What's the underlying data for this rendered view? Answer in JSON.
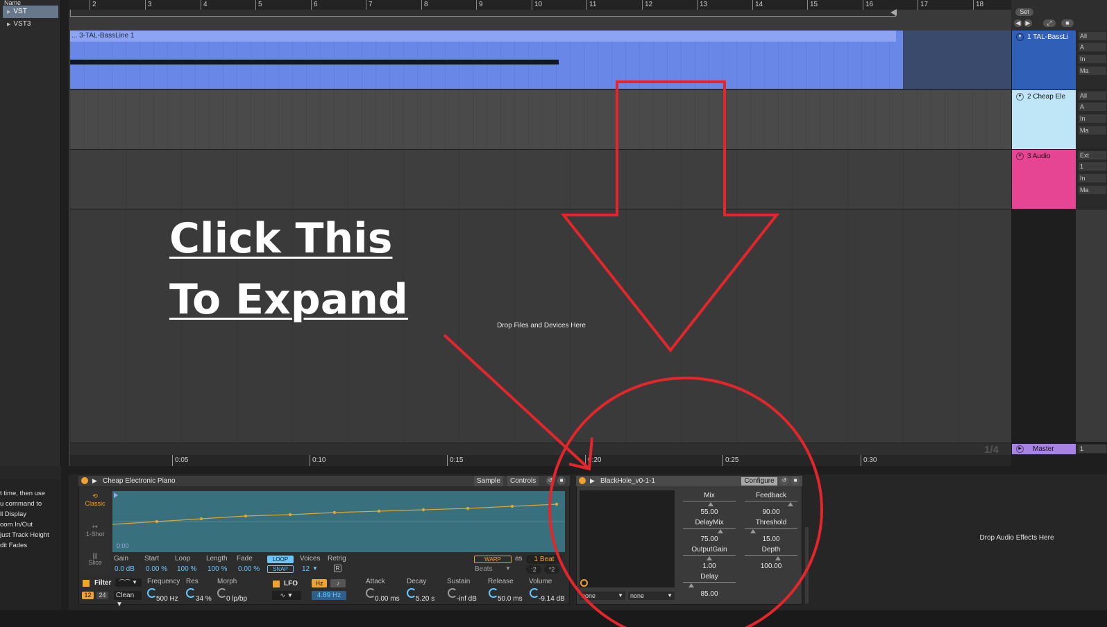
{
  "browser": {
    "header": "Name",
    "items": [
      {
        "label": "VST",
        "selected": true
      },
      {
        "label": "VST3",
        "selected": false
      }
    ]
  },
  "info": {
    "lines": [
      "t time, then use",
      "u command to",
      "",
      "ll Display",
      "oom In/Out",
      "just Track Height",
      "dit Fades"
    ]
  },
  "ruler": {
    "bars": [
      "2",
      "3",
      "4",
      "5",
      "6",
      "7",
      "8",
      "9",
      "10",
      "11",
      "12",
      "13",
      "14",
      "15",
      "16",
      "17",
      "18"
    ]
  },
  "corner": {
    "set_label": "Set"
  },
  "tracks": [
    {
      "name": "1 TAL-BassLi",
      "color": "#2f5fb6",
      "io": [
        "All",
        "A",
        "In",
        "Ma"
      ]
    },
    {
      "name": "2 Cheap Ele",
      "color": "#bfe6f7",
      "io": [
        "All",
        "A",
        "In",
        "Ma"
      ]
    },
    {
      "name": "3 Audio",
      "color": "#e54592",
      "io": [
        "Ext",
        "1",
        "In",
        "Ma"
      ]
    }
  ],
  "clip": {
    "name": "... 3-TAL-BassLine 1"
  },
  "arrangement": {
    "drop_text": "Drop Files and Devices Here",
    "quantize": "1/4"
  },
  "master": {
    "name": "Master",
    "io": "1"
  },
  "time_ruler": {
    "labels": [
      "0:05",
      "0:10",
      "0:15",
      "0:20",
      "0:25",
      "0:30"
    ]
  },
  "sampler": {
    "title": "Cheap Electronic Piano",
    "tabs": [
      "Sample",
      "Controls"
    ],
    "modes": [
      "Classic",
      "1-Shot",
      "Slice"
    ],
    "wave_start": "0:00",
    "params": [
      {
        "label": "Gain",
        "value": "0.0 dB"
      },
      {
        "label": "Start",
        "value": "0.00 %"
      },
      {
        "label": "Loop",
        "value": "100 %"
      },
      {
        "label": "Length",
        "value": "100 %"
      },
      {
        "label": "Fade",
        "value": "0.00 %"
      }
    ],
    "loop_btn": "LOOP",
    "snap_btn": "SNAP",
    "voices_label": "Voices",
    "voices_value": "12",
    "retrig_label": "Retrig",
    "retrig_value": "R",
    "warp_btn": "WARP",
    "as_label": "as",
    "beat_value": "1 Beat",
    "beats_mode": "Beats",
    "div2": ":2",
    "mul2": "*2",
    "filter": {
      "label": "Filter",
      "slope_12": "12",
      "slope_24": "24",
      "circuit": "Clean",
      "freq_label": "Frequency",
      "freq_value": "500 Hz",
      "res_label": "Res",
      "res_value": "34 %",
      "morph_label": "Morph",
      "morph_value": "0 lp/bp"
    },
    "lfo": {
      "label": "LFO",
      "hz_btn": "Hz",
      "note_btn": "♪",
      "rate": "4.89 Hz"
    },
    "env": [
      {
        "label": "Attack",
        "value": "0.00 ms"
      },
      {
        "label": "Decay",
        "value": "5.20 s"
      },
      {
        "label": "Sustain",
        "value": "-inf dB"
      },
      {
        "label": "Release",
        "value": "50.0 ms"
      },
      {
        "label": "Volume",
        "value": "-9.14 dB"
      }
    ]
  },
  "blackhole": {
    "title": "BlackHole_v0-1-1",
    "configure": "Configure",
    "dropdowns": [
      "none",
      "none"
    ],
    "params": [
      {
        "label": "Mix",
        "value": "55.00"
      },
      {
        "label": "Feedback",
        "value": "90.00"
      },
      {
        "label": "DelayMix",
        "value": "75.00"
      },
      {
        "label": "Threshold",
        "value": "15.00"
      },
      {
        "label": "OutputGain",
        "value": "1.00"
      },
      {
        "label": "Depth",
        "value": "100.00"
      },
      {
        "label": "Delay",
        "value": "85.00"
      }
    ]
  },
  "drop_fx": "Drop Audio Effects Here",
  "annotation": {
    "line1": "Click This",
    "line2": "To Expand",
    "color": "#e3262b"
  }
}
